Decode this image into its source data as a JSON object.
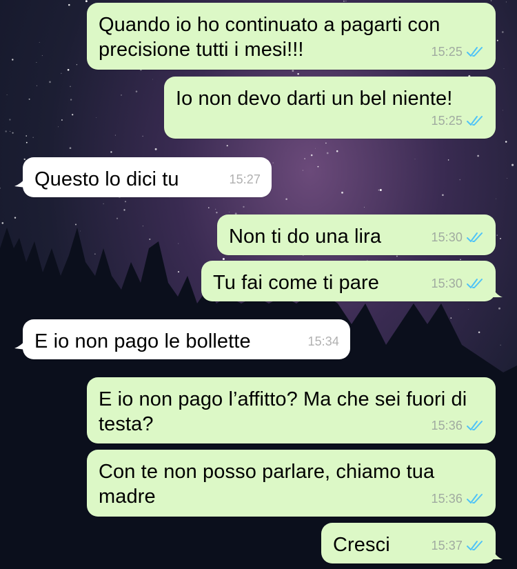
{
  "colors": {
    "outgoing_bubble": "#dcf8c6",
    "incoming_bubble": "#ffffff",
    "read_check": "#4fc3f7"
  },
  "messages": [
    {
      "direction": "out",
      "text": "Quando io ho continuato a pagarti con precisione tutti i mesi!!!",
      "time": "15:25",
      "status_icon": "double-check-read-icon"
    },
    {
      "direction": "out",
      "text": "Io non devo darti un bel niente!",
      "time": "15:25",
      "status_icon": "double-check-read-icon"
    },
    {
      "direction": "in",
      "text": "Questo lo dici tu",
      "time": "15:27"
    },
    {
      "direction": "out",
      "text": "Non ti do una lira",
      "time": "15:30",
      "status_icon": "double-check-read-icon"
    },
    {
      "direction": "out",
      "text": "Tu fai come ti pare",
      "time": "15:30",
      "status_icon": "double-check-read-icon"
    },
    {
      "direction": "in",
      "text": "E io non pago le bollette",
      "time": "15:34"
    },
    {
      "direction": "out",
      "text": "E io non pago l’affitto? Ma che sei fuori di testa?",
      "time": "15:36",
      "status_icon": "double-check-read-icon"
    },
    {
      "direction": "out",
      "text": "Con te non posso parlare, chiamo tua madre",
      "time": "15:36",
      "status_icon": "double-check-read-icon"
    },
    {
      "direction": "out",
      "text": "Cresci",
      "time": "15:37",
      "status_icon": "double-check-read-icon"
    }
  ]
}
